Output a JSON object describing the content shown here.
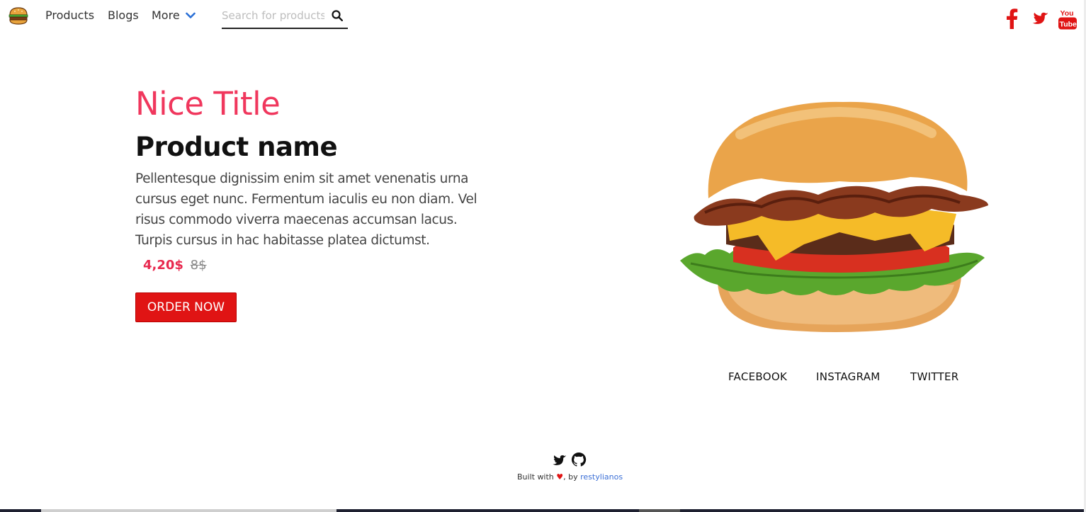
{
  "nav": {
    "logo": "burger-logo-icon",
    "links": [
      {
        "label": "Products"
      },
      {
        "label": "Blogs"
      },
      {
        "label": "More"
      }
    ],
    "search": {
      "placeholder": "Search for products",
      "value": ""
    },
    "social_icons": [
      "facebook-icon",
      "twitter-icon",
      "youtube-icon"
    ]
  },
  "hero": {
    "title": "Nice Title",
    "product_name": "Product name",
    "description": "Pellentesque dignissim enim sit amet venenatis urna cursus eget nunc. Fermentum iaculis eu non diam. Vel risus commodo viverra maecenas accumsan lacus. Turpis cursus in hac habitasse platea dictumst.",
    "price_new": "4,20$",
    "price_old": "8$",
    "order_label": "ORDER NOW"
  },
  "social_links": [
    {
      "label": "FACEBOOK"
    },
    {
      "label": "INSTAGRAM"
    },
    {
      "label": "TWITTER"
    }
  ],
  "footer": {
    "built_with": "Built with",
    "heart": "♥",
    "by": ", by",
    "author": "restylianos"
  },
  "colors": {
    "title": "#f0375d",
    "price": "#e8284e",
    "button": "#e01414",
    "social_red": "#e01414",
    "chevron_blue": "#2a6fd6",
    "author_link": "#3b6fd6"
  }
}
